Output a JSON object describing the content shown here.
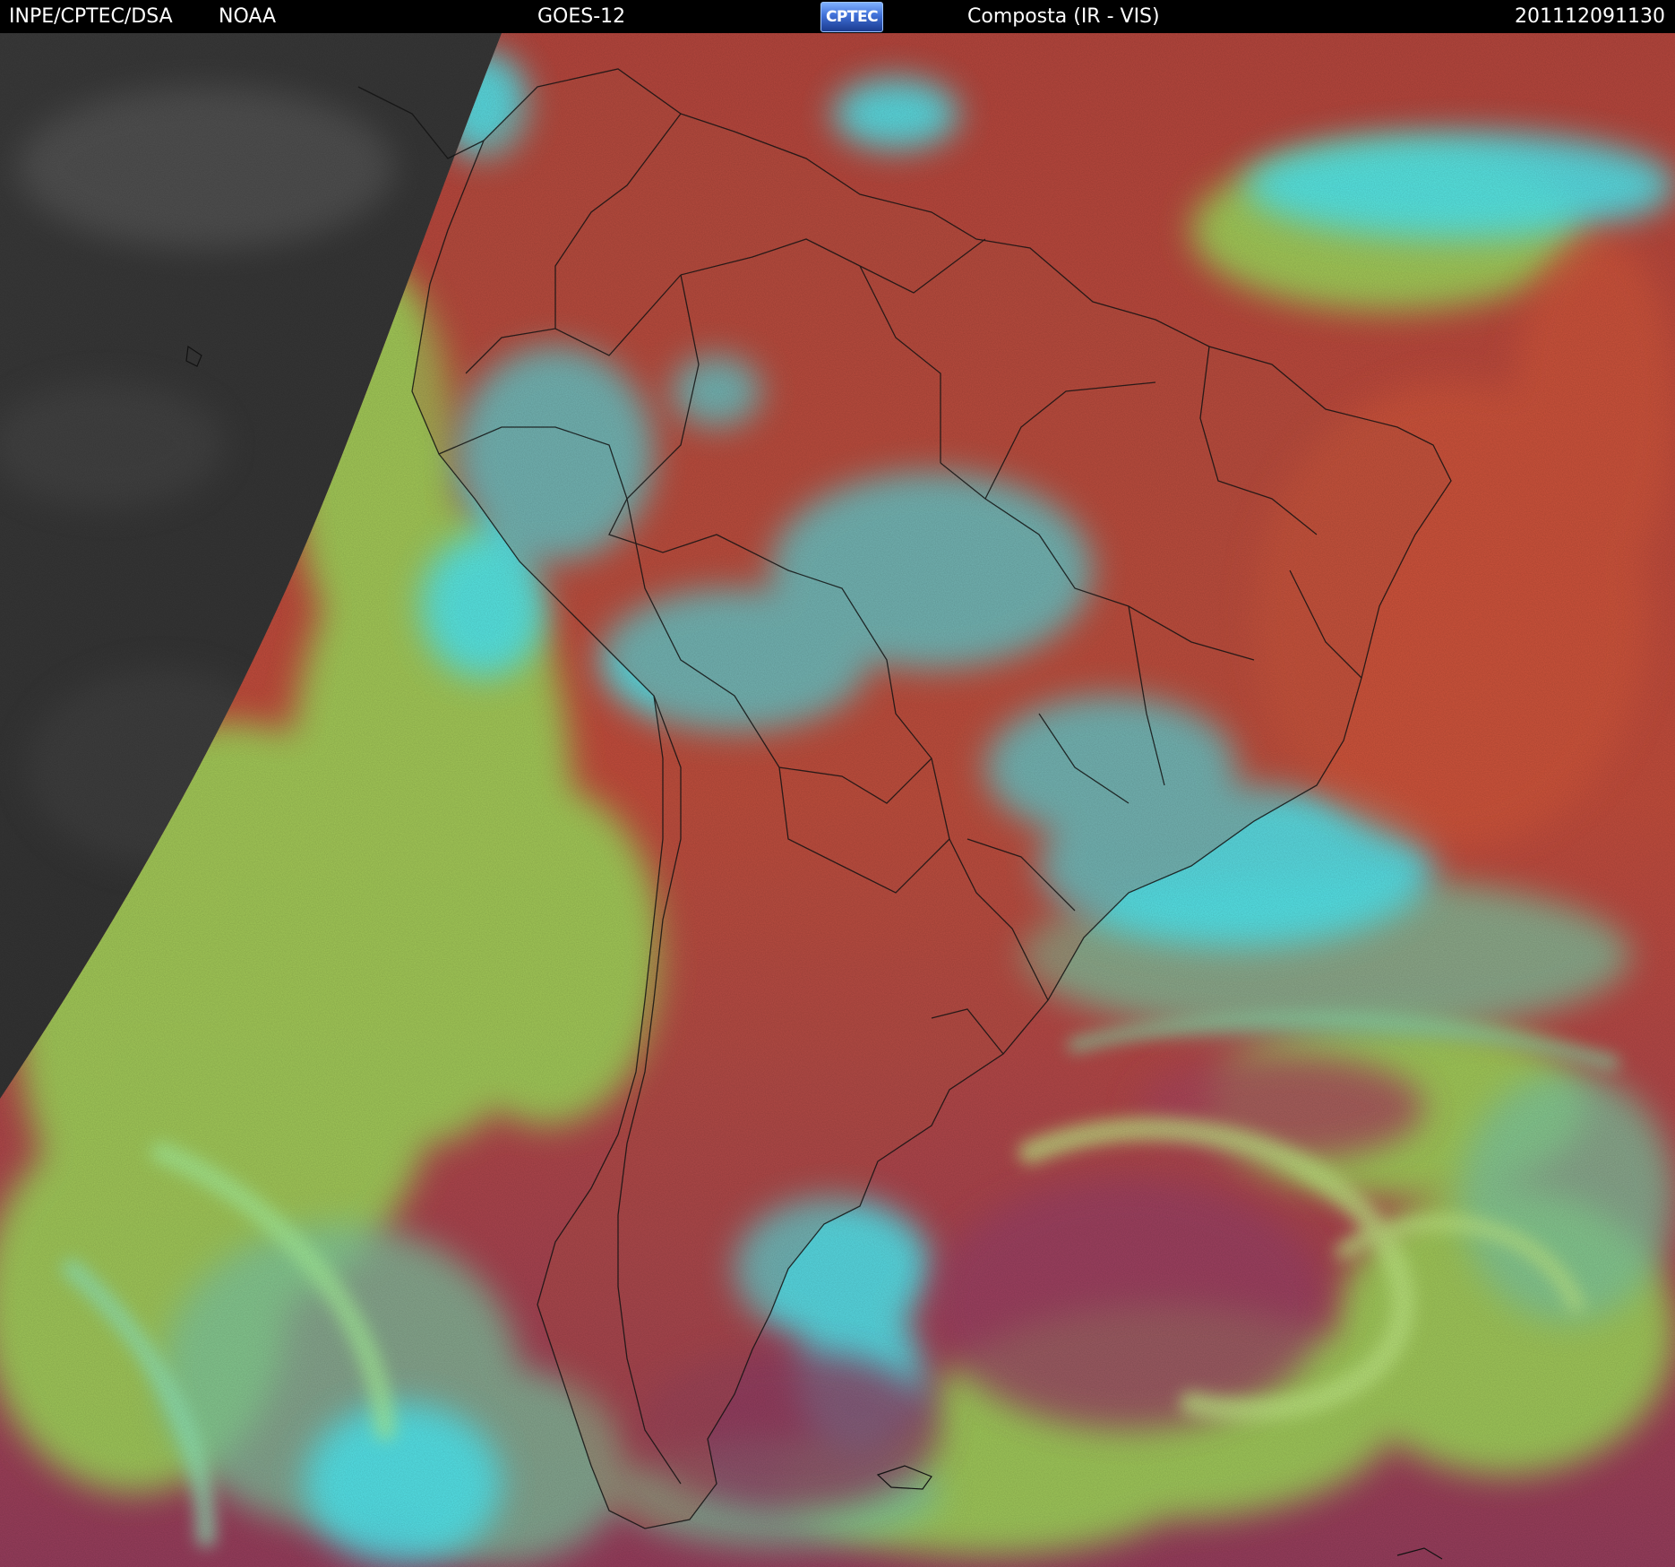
{
  "header": {
    "source": "INPE/CPTEC/DSA",
    "agency": "NOAA",
    "satellite": "GOES-12",
    "logo_text": "CPTEC",
    "product": "Composta (IR - VIS)",
    "timestamp": "201112091130"
  },
  "map": {
    "colors": {
      "night_side": "#2c2c2c",
      "ocean_clear": "#b0463f",
      "ocean_warm": "#c9523a",
      "land_clear": "#b5513f",
      "low_cloud": "#9fd55a",
      "high_cloud": "#4fe7ef",
      "mid_cloud": "#86c98d",
      "southern_ocean": "#9b3f5f",
      "boundaries": "#1a1a1a"
    }
  }
}
